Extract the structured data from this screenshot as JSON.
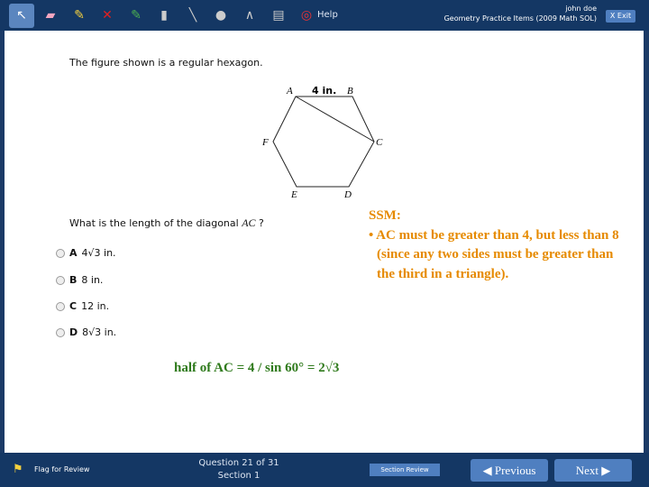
{
  "toolbar": {
    "tools": [
      "pointer-icon",
      "eraser-icon",
      "highlighter-icon",
      "cross-out-icon",
      "marker-icon",
      "ruler-icon",
      "line-icon",
      "point-icon",
      "compass-icon",
      "formula-sheet-icon",
      "help-icon"
    ],
    "help_label": "Help",
    "user_name": "john doe",
    "test_name": "Geometry Practice Items (2009 Math SOL)",
    "exit_label": "X Exit"
  },
  "question": {
    "stem": "The figure shown is a regular hexagon.",
    "side_label": "4 in.",
    "vertices": [
      "A",
      "B",
      "C",
      "D",
      "E",
      "F"
    ],
    "prompt": "What is the length of the diagonal",
    "prompt_var": "AC",
    "prompt_end": " ?",
    "options": [
      {
        "letter": "A",
        "value": "4√3 in."
      },
      {
        "letter": "B",
        "value": "8 in."
      },
      {
        "letter": "C",
        "value": "12 in."
      },
      {
        "letter": "D",
        "value": "8√3 in."
      }
    ]
  },
  "annotations": {
    "ssm_title": "SSM:",
    "ssm_text": "• AC must be greater than 4, but less than 8 (since any two sides must be greater than the third in a triangle).",
    "note": "half of AC = 4 / sin 60° = 2√3"
  },
  "footer": {
    "flag_label": "Flag for Review",
    "question_counter": "Question 21 of 31",
    "section": "Section 1",
    "section_review": "Section Review",
    "previous": "◀ Previous",
    "next": "Next ▶"
  },
  "colors": {
    "bar": "#143764",
    "button": "#4f7fc0",
    "ssm": "#e68a00",
    "note": "#2f7a1c"
  }
}
